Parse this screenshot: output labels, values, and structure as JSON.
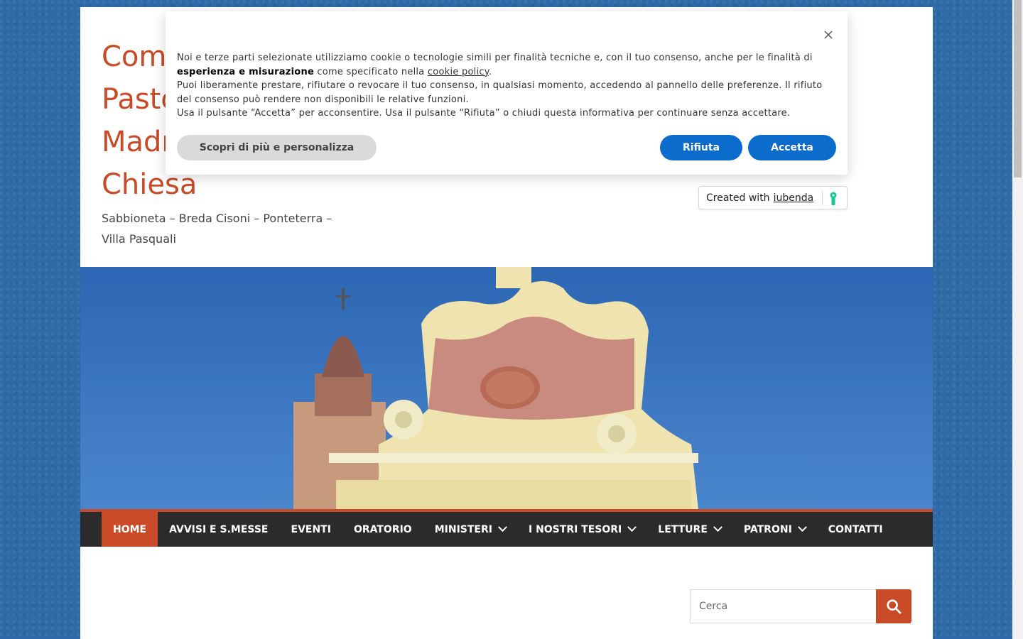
{
  "site": {
    "title_lines": [
      "Comunità",
      "Pastorale",
      "Madre",
      "Chiesa"
    ],
    "tagline": "Sabbioneta – Breda Cisoni – Ponteterra – Villa Pasquali"
  },
  "nav": {
    "items": [
      {
        "label": "HOME",
        "active": true,
        "has_dropdown": false
      },
      {
        "label": "AVVISI E S.MESSE",
        "active": false,
        "has_dropdown": false
      },
      {
        "label": "EVENTI",
        "active": false,
        "has_dropdown": false
      },
      {
        "label": "ORATORIO",
        "active": false,
        "has_dropdown": false
      },
      {
        "label": "MINISTERI",
        "active": false,
        "has_dropdown": true
      },
      {
        "label": "I NOSTRI TESORI",
        "active": false,
        "has_dropdown": true
      },
      {
        "label": "LETTURE",
        "active": false,
        "has_dropdown": true
      },
      {
        "label": "PATRONI",
        "active": false,
        "has_dropdown": true
      },
      {
        "label": "CONTATTI",
        "active": false,
        "has_dropdown": false
      }
    ]
  },
  "search": {
    "placeholder": "Cerca"
  },
  "cookie_banner": {
    "text_part1": "Noi e terze parti selezionate utilizziamo cookie o tecnologie simili per finalità tecniche e, con il tuo consenso, anche per le finalità di ",
    "text_bold": "esperienza e misurazione",
    "text_part2": " come specificato nella ",
    "text_link": "cookie policy",
    "text_part3": ".",
    "line2": "Puoi liberamente prestare, rifiutare o revocare il tuo consenso, in qualsiasi momento, accedendo al pannello delle preferenze. Il rifiuto del consenso può rendere non disponibili le relative funzioni.",
    "line3": "Usa il pulsante “Accetta” per acconsentire. Usa il pulsante “Rifiuta” o chiudi questa informativa per continuare senza accettare.",
    "customize_label": "Scopri di più e personalizza",
    "reject_label": "Rifiuta",
    "accept_label": "Accetta"
  },
  "iubenda": {
    "prefix": "Created with",
    "brand": "iubenda"
  },
  "colors": {
    "accent": "#c84a26",
    "nav_bg": "#2b2b2b",
    "button_blue": "#0b6ccc",
    "page_bg": "#2f6aa8"
  }
}
